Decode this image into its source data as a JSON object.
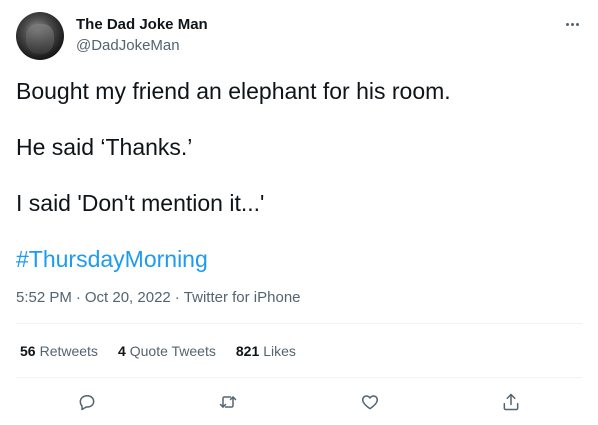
{
  "author": {
    "name": "The Dad Joke Man",
    "handle": "@DadJokeMan",
    "avatar_icon": "avatar-photo"
  },
  "tweet": {
    "lines": [
      "Bought my friend an elephant for his room.",
      "He said ‘Thanks.’",
      "I said 'Don't mention it...'"
    ],
    "hashtag": "#ThursdayMorning"
  },
  "meta": {
    "time": "5:52 PM",
    "sep1": "·",
    "date": "Oct 20, 2022",
    "sep2": "·",
    "source": "Twitter for iPhone"
  },
  "stats": {
    "retweets": {
      "count": "56",
      "label": "Retweets"
    },
    "quotes": {
      "count": "4",
      "label": "Quote Tweets"
    },
    "likes": {
      "count": "821",
      "label": "Likes"
    }
  },
  "actions": [
    "reply-icon",
    "retweet-icon",
    "like-icon",
    "share-icon"
  ],
  "colors": {
    "text": "#0f1419",
    "secondary": "#536471",
    "link": "#1d9bf0",
    "divider": "#eff3f4"
  }
}
